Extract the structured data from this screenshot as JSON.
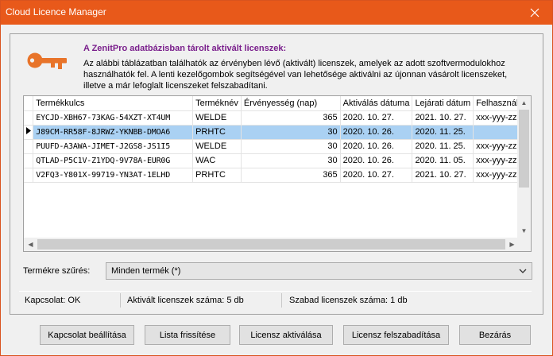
{
  "window": {
    "title": "Cloud Licence Manager"
  },
  "icons": {
    "key": "key-icon",
    "close": "close-icon",
    "row_indicator": "row-pointer-icon"
  },
  "colors": {
    "titlebar": "#e8591a",
    "heading": "#7a1f8c",
    "key": "#e8742a",
    "selection": "#aad1f3"
  },
  "header": {
    "heading": "A ZenitPro adatbázisban tárolt aktivált licenszek:",
    "desc1": "Az alábbi táblázatban találhatók az érvényben lévő (aktivált) licenszek, amelyek az adott  szoftvermodulokhoz",
    "desc2": "használhatók fel. A lenti kezelőgombok segítségével van lehetősége aktiválni az újonnan vásárolt licenszeket,",
    "desc3": "illetve a már lefoglalt licenszeket felszabadítani."
  },
  "table": {
    "columns": [
      "Termékkulcs",
      "Terméknév",
      "Érvényesség (nap)",
      "Aktiválás dátuma",
      "Lejárati dátum",
      "Felhasználás"
    ],
    "rows": [
      [
        "EYCJD-XBH67-73KAG-54XZT-XT4UM",
        "WELDE",
        "365",
        "2020. 10. 27.",
        "2021. 10. 27.",
        "xxx-yyy-zzz"
      ],
      [
        "J89CM-RR58F-8JRWZ-YKNBB-DMOA6",
        "PRHTC",
        "30",
        "2020. 10. 26.",
        "2020. 11. 25.",
        ""
      ],
      [
        "PUUFD-A3AWA-JIMET-J2GS8-JS1I5",
        "WELDE",
        "30",
        "2020. 10. 26.",
        "2020. 11. 25.",
        "xxx-yyy-zzz"
      ],
      [
        "QTLAD-P5C1V-Z1YDQ-9V78A-EUR0G",
        "WAC",
        "30",
        "2020. 10. 26.",
        "2020. 11. 05.",
        "xxx-yyy-zzz"
      ],
      [
        "V2FQ3-Y801X-99719-YN3AT-1ELHD",
        "PRHTC",
        "365",
        "2020. 10. 27.",
        "2021. 10. 27.",
        "xxx-yyy-zzz"
      ]
    ],
    "selected_row": 1
  },
  "filter": {
    "label": "Termékre szűrés:",
    "value": "Minden termék (*)"
  },
  "status": {
    "connection": "Kapcsolat: OK",
    "activated": "Aktivált licenszek száma: 5 db",
    "free": "Szabad licenszek száma: 1 db"
  },
  "buttons": {
    "connection": "Kapcsolat beállítása",
    "refresh": "Lista frissítése",
    "activate": "Licensz aktiválása",
    "release": "Licensz felszabadítása",
    "close": "Bezárás"
  }
}
